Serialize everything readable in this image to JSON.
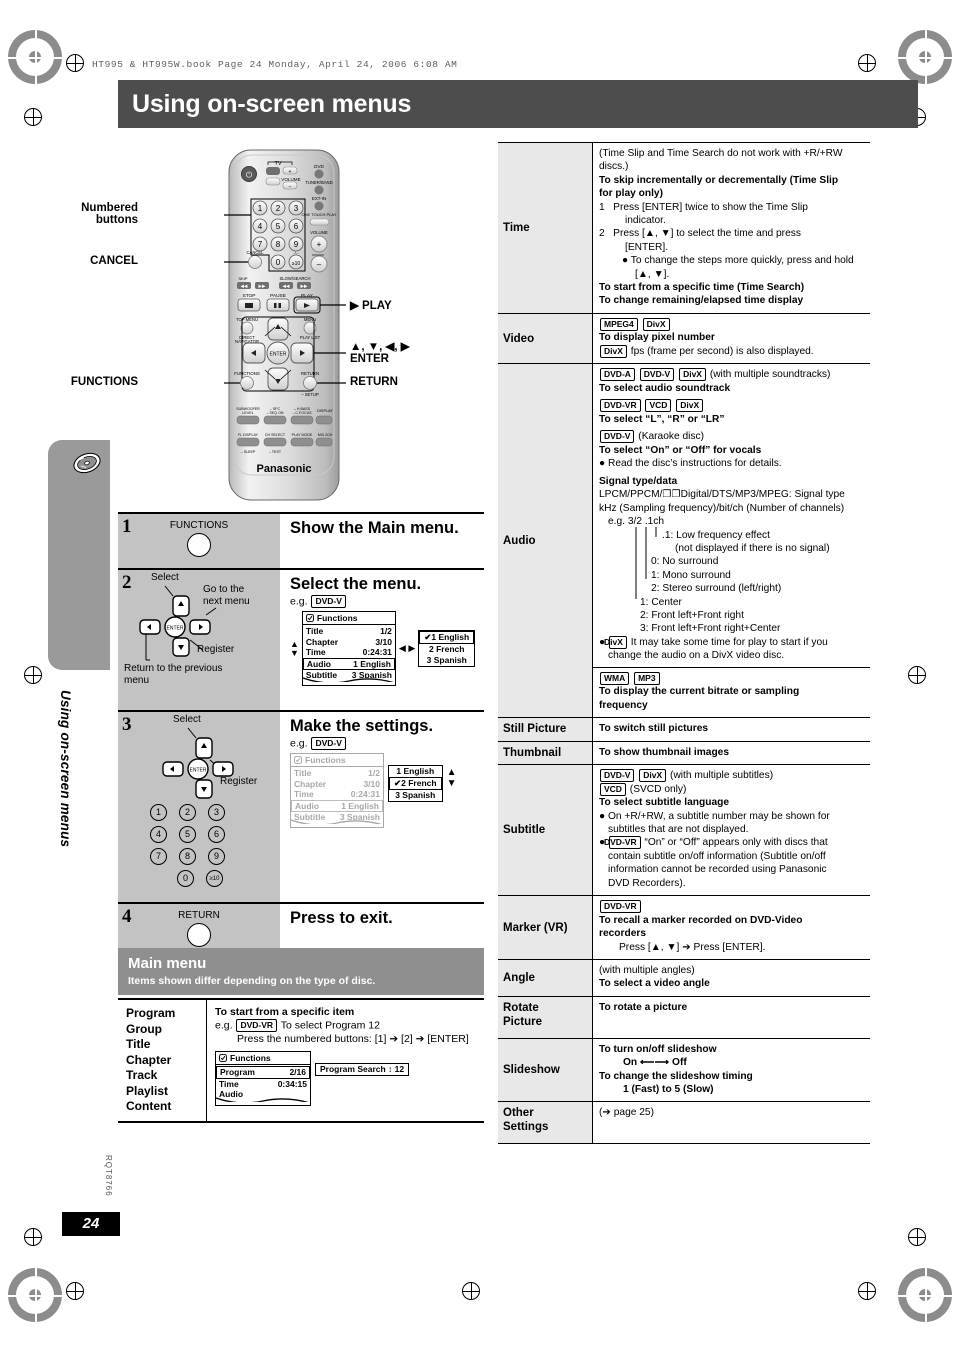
{
  "page": {
    "running_head": "HT995 & HT995W.book  Page 24  Monday, April 24, 2006  6:08 AM",
    "title": "Using on-screen menus",
    "side_tab_label": "Using on-screen menus",
    "doc_code": "RQT8766",
    "page_number": "24"
  },
  "remote": {
    "brand": "Panasonic",
    "callouts": {
      "numbered_buttons": "Numbered\nbuttons",
      "numbered_buttons_l1": "Numbered",
      "numbered_buttons_l2": "buttons",
      "cancel": "CANCEL",
      "functions": "FUNCTIONS",
      "play": "▶ PLAY",
      "cursor": "▲, ▼, ◀, ▶",
      "enter": "ENTER",
      "return": "RETURN"
    },
    "keys": {
      "tv": "TV",
      "tv_av": "TV/AV",
      "volume": "VOLUME",
      "dvd": "DVD",
      "tuner_band": "TUNER/BAND",
      "ext_in": "EXT-IN",
      "one_touch_play": "ONE TOUCH PLAY",
      "vol": "VOLUME",
      "skip": "SKIP",
      "slow_search": "SLOW/SEARCH",
      "stop": "STOP",
      "pause": "PAUSE",
      "play": "PLAY",
      "top_menu": "TOP MENU",
      "direct_navigator": "DIRECT NAVIGATOR",
      "menu": "MENU",
      "play_list": "PLAY LIST",
      "enter": "ENTER",
      "functions": "FUNCTIONS",
      "return": "RETURN",
      "setup": "– SETUP",
      "cancel": "CANCEL",
      "subwoofer_level": "SUBWOOFER LEVEL",
      "sfc": "– SFC – SEQ ON",
      "hbass": "– H.BASS – C.FOCUS",
      "display": "DISPLAY",
      "fl_display": "FL DISPLAY",
      "ch_select": "CH SELECT",
      "play_mode": "PLAY MODE",
      "mix2ch": "MIX 2CH",
      "sleep": "– SLEEP",
      "test": "– TEST",
      "digits": [
        "1",
        "2",
        "3",
        "4",
        "5",
        "6",
        "7",
        "8",
        "9",
        "0",
        "≥10"
      ]
    }
  },
  "steps": [
    {
      "no": "1",
      "title": "Show the Main menu.",
      "button_label": "FUNCTIONS"
    },
    {
      "no": "2",
      "title": "Select the menu.",
      "eg_prefix": "e.g.",
      "eg_tag": "DVD-V",
      "labels": {
        "select": "Select",
        "next_menu_l1": "Go to the",
        "next_menu_l2": "next menu",
        "register": "Register",
        "prev_l1": "Return to the previous",
        "prev_l2": "menu",
        "enter": "ENTER"
      },
      "osd": {
        "header": "Functions",
        "rows": [
          {
            "label": "Title",
            "value": "1/2"
          },
          {
            "label": "Chapter",
            "value": "3/10"
          },
          {
            "label": "Time",
            "value": "0:24:31"
          },
          {
            "label": "Audio",
            "value": "1 English"
          },
          {
            "label": "Subtitle",
            "value": "3 Spanish"
          }
        ],
        "selected_row": "Audio"
      },
      "choices": [
        "1 English",
        "2 French",
        "3 Spanish"
      ],
      "checked": "1 English"
    },
    {
      "no": "3",
      "title": "Make the settings.",
      "eg_prefix": "e.g.",
      "eg_tag": "DVD-V",
      "labels": {
        "select": "Select",
        "register": "Register",
        "enter": "ENTER"
      },
      "osd": {
        "header": "Functions",
        "rows": [
          {
            "label": "Title",
            "value": "1/2"
          },
          {
            "label": "Chapter",
            "value": "3/10"
          },
          {
            "label": "Time",
            "value": "0:24:31"
          },
          {
            "label": "Audio",
            "value": "1 English"
          },
          {
            "label": "Subtitle",
            "value": "3 Spanish"
          }
        ]
      },
      "choices": [
        "1 English",
        "2 French",
        "3 Spanish"
      ],
      "checked": "2 French",
      "numpad": [
        "1",
        "2",
        "3",
        "4",
        "5",
        "6",
        "7",
        "8",
        "9",
        "0",
        "≥10"
      ]
    },
    {
      "no": "4",
      "title": "Press to exit.",
      "button_label": "RETURN"
    }
  ],
  "main_menu": {
    "heading": "Main menu",
    "subheading": "Items shown differ depending on the type of disc.",
    "items": [
      "Program",
      "Group",
      "Title",
      "Chapter",
      "Track",
      "Playlist",
      "Content"
    ],
    "desc_bold": "To start from a specific item",
    "desc_eg_prefix": "e.g.",
    "desc_eg_tag": "DVD-VR",
    "desc_eg_text": "To select Program 12",
    "desc_press": "Press the numbered buttons: [1] ➔ [2] ➔ [ENTER]",
    "osd": {
      "header": "Functions",
      "rows": [
        {
          "label": "Program",
          "value": "2/16"
        },
        {
          "label": "Time",
          "value": "0:34:15"
        },
        {
          "label": "Audio",
          "value": ""
        }
      ],
      "selected_row": "Program",
      "side_box": "Program Search ↕ 12"
    }
  },
  "feature_table": [
    {
      "name": "Time",
      "lines": [
        {
          "t": "(Time Slip and Time Search do not work with +R/+RW",
          "style": "normal"
        },
        {
          "t": "discs.)",
          "style": "normal"
        },
        {
          "t": "To skip incrementally or decrementally (Time Slip",
          "style": "bold"
        },
        {
          "t": "for play only)",
          "style": "bold"
        },
        {
          "t": "1   Press [ENTER] twice to show the Time Slip",
          "style": "normal"
        },
        {
          "t": "indicator.",
          "style": "indent1"
        },
        {
          "t": "2   Press [▲, ▼] to select the time and press",
          "style": "normal"
        },
        {
          "t": "[ENTER].",
          "style": "indent1"
        },
        {
          "t": "● To change the steps more quickly, press and hold",
          "style": "indent2"
        },
        {
          "t": "[▲, ▼].",
          "style": "indent3"
        },
        {
          "t": "To start from a specific time (Time Search)",
          "style": "bold"
        },
        {
          "t": "To change remaining/elapsed time display",
          "style": "bold"
        }
      ]
    },
    {
      "name": "Video",
      "tags_row": [
        "MPEG4",
        "DivX"
      ],
      "lines": [
        {
          "t": "To display pixel number",
          "style": "bold"
        },
        {
          "t": "fps (frame per second) is also displayed.",
          "style": "tagline",
          "tag": "DivX"
        }
      ]
    },
    {
      "name": "Audio",
      "blocks": [
        {
          "tags": [
            "DVD-A",
            "DVD-V",
            "DivX"
          ],
          "suffix": "(with multiple soundtracks)",
          "bold_line": "To select audio soundtrack"
        },
        {
          "tags": [
            "DVD-VR",
            "VCD",
            "DivX"
          ],
          "suffix": "",
          "bold_line": "To select “L”, “R” or “LR”"
        },
        {
          "tags": [
            "DVD-V"
          ],
          "suffix": "(Karaoke disc)",
          "bold_line": "To select “On” or “Off” for vocals",
          "bullet": "● Read the disc’s instructions for details."
        }
      ],
      "signal": {
        "title": "Signal type/data",
        "l1": "LPCM/PPCM/❐❐Digital/DTS/MP3/MPEG:  Signal type",
        "l2": "kHz (Sampling frequency)/bit/ch (Number of channels)",
        "l3": "e.g.  3/2 .1ch",
        "legend": [
          ".1:  Low frequency effect",
          "(not displayed if there is no signal)",
          "0:  No surround",
          "1:  Mono surround",
          "2:  Stereo surround (left/right)",
          "1:  Center",
          "2:  Front left+Front right",
          "3:  Front left+Front right+Center"
        ],
        "note_tag": "DivX",
        "note_l1": "It may take some time for play to start if you",
        "note_l2": "change the audio on a DivX video disc."
      },
      "sub_block": {
        "tags": [
          "WMA",
          "MP3"
        ],
        "bold_l1": "To display the current bitrate or sampling",
        "bold_l2": "frequency"
      }
    },
    {
      "name": "Still Picture",
      "lines": [
        {
          "t": "To switch still pictures",
          "style": "bold"
        }
      ]
    },
    {
      "name": "Thumbnail",
      "lines": [
        {
          "t": "To show thumbnail images",
          "style": "bold"
        }
      ]
    },
    {
      "name": "Subtitle",
      "blocks": [
        {
          "tags": [
            "DVD-V",
            "DivX"
          ],
          "suffix": "(with multiple subtitles)"
        },
        {
          "tags": [
            "VCD"
          ],
          "suffix": "(SVCD only)"
        }
      ],
      "lines": [
        {
          "t": "To select subtitle language",
          "style": "bold"
        },
        {
          "t": "● On +R/+RW, a subtitle number may be shown for",
          "style": "bullet"
        },
        {
          "t": "subtitles that are not displayed.",
          "style": "indent1b"
        },
        {
          "t": "“On” or “Off” appears only with discs that",
          "style": "bullet-tag",
          "tag": "DVD-VR"
        },
        {
          "t": "contain subtitle on/off information (Subtitle on/off",
          "style": "indent1b"
        },
        {
          "t": "information cannot be recorded using Panasonic",
          "style": "indent1b"
        },
        {
          "t": "DVD Recorders).",
          "style": "indent1b"
        }
      ]
    },
    {
      "name": "Marker (VR)",
      "tags_row": [
        "DVD-VR"
      ],
      "lines": [
        {
          "t": "To recall a marker recorded on DVD-Video",
          "style": "bold"
        },
        {
          "t": "recorders",
          "style": "bold"
        },
        {
          "t": "Press [▲, ▼] ➔ Press [ENTER].",
          "style": "indent2n"
        }
      ]
    },
    {
      "name": "Angle",
      "lines": [
        {
          "t": "(with multiple angles)",
          "style": "normal"
        },
        {
          "t": "To select a video angle",
          "style": "bold"
        }
      ]
    },
    {
      "name": "Rotate Picture",
      "name_l1": "Rotate",
      "name_l2": "Picture",
      "lines": [
        {
          "t": "To rotate a picture",
          "style": "bold"
        }
      ]
    },
    {
      "name": "Slideshow",
      "lines": [
        {
          "t": "To turn on/off slideshow",
          "style": "bold"
        },
        {
          "t": "On ⟵⟶ Off",
          "style": "boldindent"
        },
        {
          "t": "To change the slideshow timing",
          "style": "bold"
        },
        {
          "t": "1 (Fast) to 5 (Slow)",
          "style": "boldindent"
        }
      ]
    },
    {
      "name": "Other Settings",
      "name_l1": "Other",
      "name_l2": "Settings",
      "lines": [
        {
          "t": "(➔ page 25)",
          "style": "normal"
        }
      ]
    }
  ]
}
